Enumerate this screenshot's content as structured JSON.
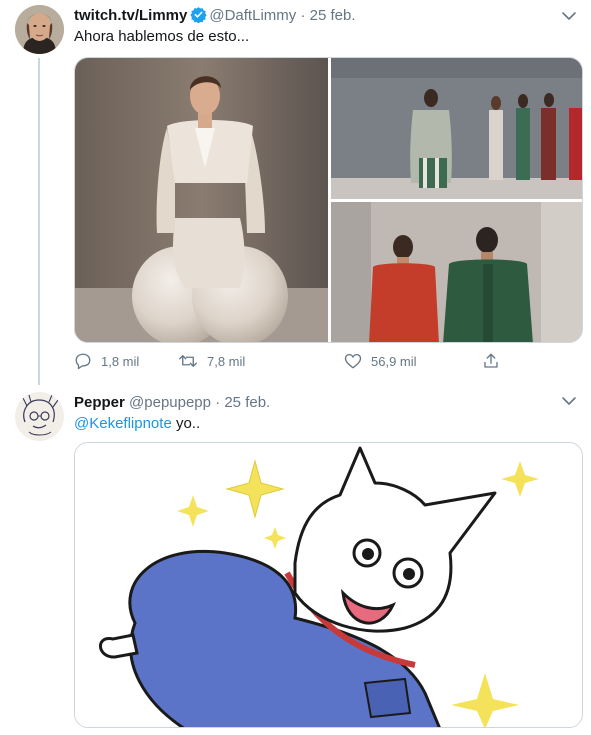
{
  "tweets": [
    {
      "name": "twitch.tv/Limmy",
      "handle": "@DaftLimmy",
      "separator": "·",
      "date": "25 feb.",
      "text": "Ahora hablemos de esto...",
      "verified": true,
      "actions": {
        "reply": "1,8 mil",
        "retweet": "7,8 mil",
        "like": "56,9 mil"
      }
    },
    {
      "name": "Pepper",
      "handle": "@pepupepp",
      "separator": "·",
      "date": "25 feb.",
      "mention": "@Kekeflipnote",
      "text": " yo.."
    }
  ],
  "colors": {
    "link": "#1b95e0",
    "secondary": "#657786",
    "verified": "#1da1f2",
    "thread": "#ccd6dd"
  }
}
